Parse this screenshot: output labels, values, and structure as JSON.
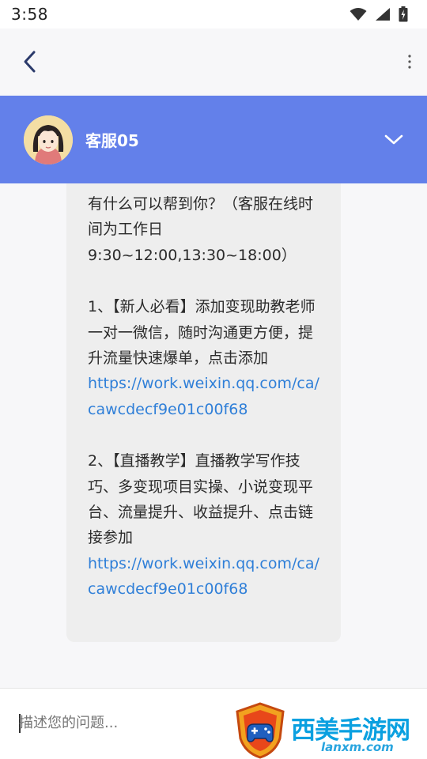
{
  "status_bar": {
    "time": "3:58",
    "icons": [
      "wifi-icon",
      "signal-icon",
      "battery-icon"
    ]
  },
  "nav": {
    "back_icon": "chevron-left-icon",
    "more_icon": "more-vertical-icon"
  },
  "agent": {
    "name": "客服05",
    "collapse_icon": "chevron-down-icon",
    "bar_color": "#6380ea"
  },
  "message": {
    "intro": "有什么可以帮到你？（客服在线时间为工作日9:30~12:00,13:30~18:00）",
    "item1_text": "1、【新人必看】添加变现助教老师一对一微信，随时沟通更方便，提升流量快速爆单，点击添加",
    "item1_link": "https://work.weixin.qq.com/ca/cawcdecf9e01c00f68",
    "item2_text": "2、【直播教学】直播教学写作技巧、多变现项目实操、小说变现平台、流量提升、收益提升、点击链接参加",
    "item2_link": "https://work.weixin.qq.com/ca/cawcdecf9e01c00f68",
    "link_color": "#2f7fd8"
  },
  "composer": {
    "placeholder": "描述您的问题..."
  },
  "watermark": {
    "text": "西美手游网",
    "sub": "lanxm.com"
  }
}
